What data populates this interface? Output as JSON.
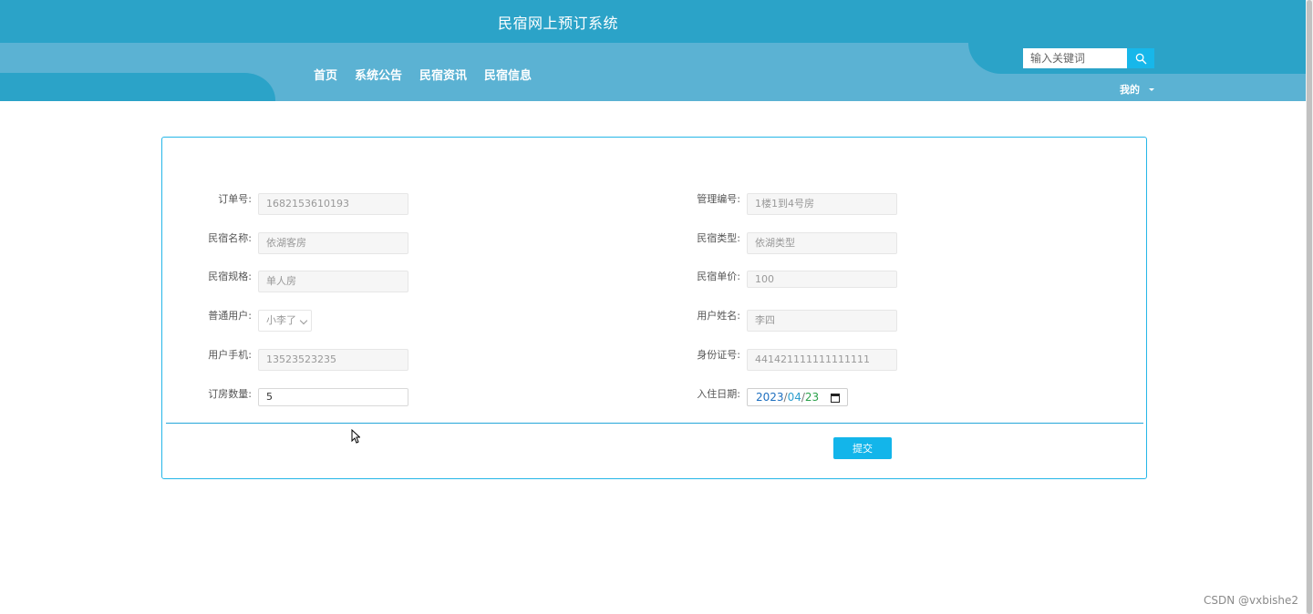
{
  "site": {
    "title": "民宿网上预订系统"
  },
  "nav": [
    {
      "label": "首页"
    },
    {
      "label": "系统公告"
    },
    {
      "label": "民宿资讯"
    },
    {
      "label": "民宿信息"
    }
  ],
  "search": {
    "placeholder": "输入关键词",
    "icon": "search-icon"
  },
  "user_menu": {
    "label": "我的"
  },
  "form": {
    "order_no": {
      "label": "订单号:",
      "value": "1682153610193"
    },
    "manage_no": {
      "label": "管理编号:",
      "value": "1楼1到4号房"
    },
    "homestay_name": {
      "label": "民宿名称:",
      "value": "依湖客房"
    },
    "homestay_type": {
      "label": "民宿类型:",
      "value": "依湖类型"
    },
    "homestay_spec": {
      "label": "民宿规格:",
      "value": "单人房"
    },
    "homestay_price": {
      "label": "民宿单价:",
      "value": "100"
    },
    "normal_user": {
      "label": "普通用户:",
      "value": "小李了"
    },
    "user_name": {
      "label": "用户姓名:",
      "value": "李四"
    },
    "user_phone": {
      "label": "用户手机:",
      "value": "13523523235"
    },
    "id_card": {
      "label": "身份证号:",
      "value": "441421111111111111"
    },
    "room_count": {
      "label": "订房数量:",
      "value": "5"
    },
    "checkin_date": {
      "label": "入住日期:",
      "year": "2023",
      "month": "04",
      "day": "23",
      "sep": "/"
    },
    "submit_label": "提交"
  },
  "watermark": "CSDN @vxbishe2",
  "colors": {
    "header": "#2ba3c8",
    "band": "#5bb2d3",
    "accent": "#13b5ea"
  }
}
